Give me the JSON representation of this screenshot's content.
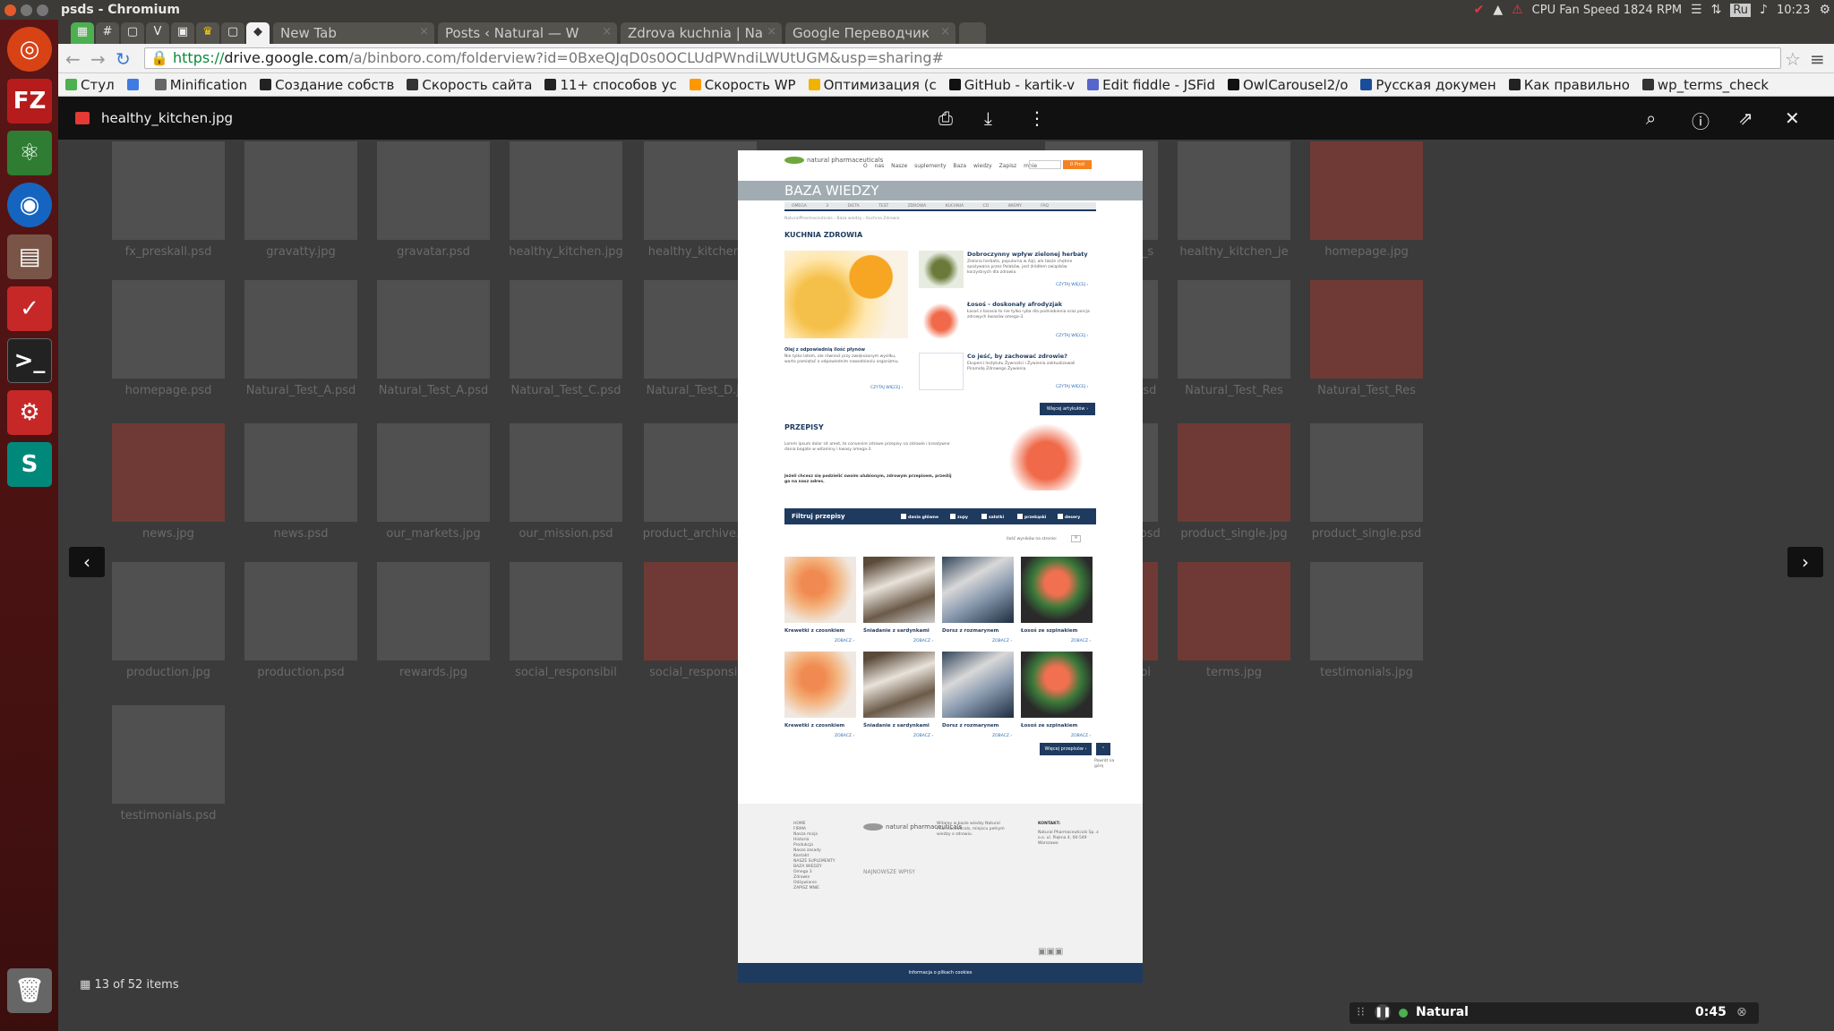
{
  "system": {
    "window_title": "psds - Chromium",
    "tray": {
      "cpu": "CPU Fan Speed 1824 RPM",
      "lang": "Ru",
      "time": "10:23"
    }
  },
  "browser": {
    "tabs": [
      {
        "label": "New Tab"
      },
      {
        "label": "Posts ‹ Natural — W"
      },
      {
        "label": "Zdrova kuchnia | Na"
      },
      {
        "label": "Google Переводчик"
      }
    ],
    "url_scheme": "https://",
    "url_host": "drive.google.com",
    "url_path": "/a/binboro.com/folderview?id=0BxeQJqD0s0OCLUdPWndiLWUtUGM&usp=sharing#",
    "bookmarks": [
      {
        "label": "Стул",
        "icon": "chrome-icon",
        "color": "#4caf50"
      },
      {
        "label": "",
        "icon": "translate-icon",
        "color": "#3f7be0"
      },
      {
        "label": "Minification",
        "icon": "folder-icon",
        "color": "#666666"
      },
      {
        "label": "Создание собств",
        "icon": "w-icon",
        "color": "#222222"
      },
      {
        "label": "Скорость сайта",
        "icon": "p-icon",
        "color": "#333333"
      },
      {
        "label": "11+ способов ус",
        "icon": "h-icon",
        "color": "#222222"
      },
      {
        "label": "Скорость WP",
        "icon": "chart-icon",
        "color": "#ff9800"
      },
      {
        "label": "Оптимизация (с",
        "icon": "cup-icon",
        "color": "#f0b400"
      },
      {
        "label": "GitHub - kartik-v",
        "icon": "github-icon",
        "color": "#111111"
      },
      {
        "label": "Edit fiddle - JSFid",
        "icon": "fiddle-icon",
        "color": "#5566cc"
      },
      {
        "label": "OwlCarousel2/o",
        "icon": "github-icon",
        "color": "#111111"
      },
      {
        "label": "Русская докумен",
        "icon": "doc-icon",
        "color": "#1a4d99"
      },
      {
        "label": "Как правильно",
        "icon": "t-icon",
        "color": "#222222"
      },
      {
        "label": "wp_terms_check",
        "icon": "pen-icon",
        "color": "#333333"
      }
    ]
  },
  "viewer": {
    "file_name": "healthy_kitchen.jpg",
    "counter": "13 of 52 items",
    "background_files": [
      "fx_preskall.psd",
      "gravatty.jpg",
      "gravatar.psd",
      "healthy_kitchen.jpg",
      "healthy_kitchen_s",
      "healthy_kitchen_s",
      "healthy_kitchen_je",
      "homepage.jpg",
      "homepage.psd",
      "Natural_Test_A.psd",
      "Natural_Test_A.psd",
      "Natural_Test_C.psd",
      "Natural_Test_D.jpg",
      "Natural_Test_B.psd",
      "Natural_Test_Res",
      "Natural_Test_Res",
      "news.jpg",
      "news.psd",
      "our_markets.jpg",
      "our_mission.psd",
      "product_archive.jpg",
      "product_archive.psd",
      "product_single.jpg",
      "product_single.psd",
      "production.jpg",
      "production.psd",
      "rewards.jpg",
      "social_responsibil",
      "social_responsibil",
      "social_responsibi",
      "terms.jpg",
      "testimonials.jpg",
      "testimonials.psd"
    ],
    "player": {
      "title": "Natural",
      "time": "0:45"
    }
  },
  "doc": {
    "logo": "natural pharmaceuticals",
    "nav": "O nas Nasze suplementy Baza wiedzy Zapisz mnie",
    "cart": "0 Prod",
    "band_title": "BAZA WIEDZY",
    "subtabs": "OMEGA 3 DIETA TEST ZDROWA KUCHNIA CO WIEMY FAQ",
    "crumbs": "NaturalPharmaceuticals › Baza wiedzy › Kuchnia Zdrowia",
    "section1": "KUCHNIA ZDROWIA",
    "featured_title": "Olej z odpowiednią ilość płynów",
    "featured_text": "Nie tylko latem, ale również przy zwiększonym wysiłku, warto pamiętać o odpowiednim nawodnieniu organizmu.",
    "articles": [
      {
        "title": "Dobroczynny wpływ zielonej herbaty",
        "text": "Zielona herbata, popularna w Azji, ale także chętnie spożywana przez Polaków, jest źródłem związków korzystnych dla zdrowia."
      },
      {
        "title": "Łosoś - doskonały afrodyzjak",
        "text": "Łosoś z łososia to nie tylko ryba dla podniebienia oraz porcja zdrowych kwasów omega-3."
      },
      {
        "title": "Co jeść, by zachować zdrowie?",
        "text": "Eksperci Instytutu Żywności i Żywienia zaktualizowali Piramidę Zdrowego Żywienia."
      }
    ],
    "more_label": "CZYTAJ WIĘCEJ ›",
    "more_articles": "Więcej artykułów ›",
    "section2": "PRZEPISY",
    "recipes_text": "Lorem ipsum dolor sit amet, te convenire zdrowe przepisy na zdrowie i kreatywne dania bogate w witaminy i kwasy omega-3.",
    "recipes_bold": "Jeżeli chcesz się podzielić swoim ulubionym, zdrowym przepisem, prześlij go na nasz adres.",
    "filter_title": "Filtruj przepisy",
    "filters": [
      "dania główne",
      "zupy",
      "sałatki",
      "przekąski",
      "desery"
    ],
    "per_page_label": "Ilość wyników na stronie:",
    "per_page_value": "9",
    "recipes": [
      {
        "name": "Krewetki z czosnkiem",
        "photo": "ph-shrimp"
      },
      {
        "name": "Śniadanie z sardynkami",
        "photo": "ph-sardine"
      },
      {
        "name": "Dorsz z rozmarynem",
        "photo": "ph-dorsz"
      },
      {
        "name": "Łosoś ze szpinakiem",
        "photo": "ph-losos"
      },
      {
        "name": "Krewetki z czosnkiem",
        "photo": "ph-shrimp"
      },
      {
        "name": "Śniadanie z sardynkami",
        "photo": "ph-sardine"
      },
      {
        "name": "Dorsz z rozmarynem",
        "photo": "ph-dorsz"
      },
      {
        "name": "Łosoś ze szpinakiem",
        "photo": "ph-losos"
      }
    ],
    "see_label": "ZOBACZ ›",
    "more_recipes": "Więcej przepisów ›",
    "back_top": "Powrót na górę",
    "footer_menu": [
      "HOME",
      "FIRMA",
      "Nasza misja",
      "Historia",
      "Produkcja",
      "Nasze zasady",
      "Kontakt",
      "NASZE SUPLEMENTY",
      "BAZA WIEDZY",
      "Omega 3",
      "Zdrowie",
      "Odżywianie",
      "ZAPISZ MNIE"
    ],
    "footer_about": "Witamy w bazie wiedzy Natural Pharmaceuticals, miejscu pełnym wiedzy o zdrowiu.",
    "footer_news_title": "NAJNOWSZE WPISY",
    "footer_contact_title": "KONTAKT:",
    "footer_contact": "Natural Pharmaceuticals Sp. z o.o. ul. Piękna 4, 00-549 Warszawa",
    "footer_bar": "Informacja o plikach cookies"
  }
}
